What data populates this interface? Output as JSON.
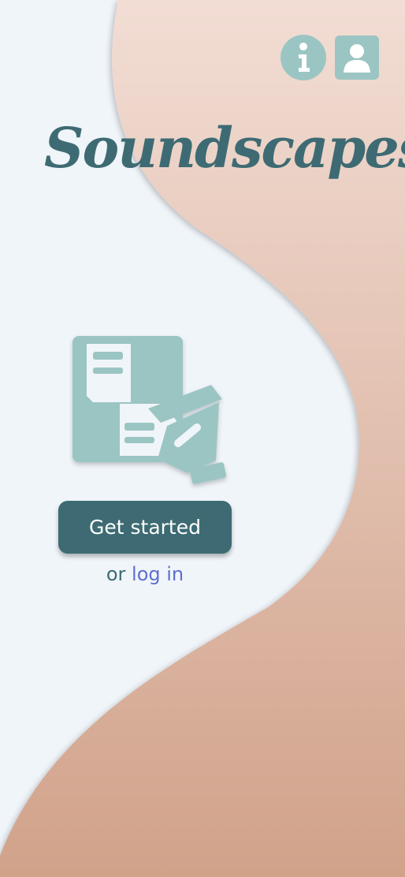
{
  "app": {
    "title": "Soundscapes"
  },
  "header": {
    "info_icon": "info-icon",
    "profile_icon": "user-profile-icon"
  },
  "hero": {
    "illustration_icon": "document-edit-icon"
  },
  "actions": {
    "get_started_label": "Get started",
    "or_text": "or",
    "login_label": "log in"
  },
  "colors": {
    "background": "#f0f5fa",
    "wave_top": "#f2ddd4",
    "wave_bottom": "#d1a28a",
    "accent": "#3e6b73",
    "icon": "#9bc5c3",
    "link": "#5e6fd0"
  }
}
